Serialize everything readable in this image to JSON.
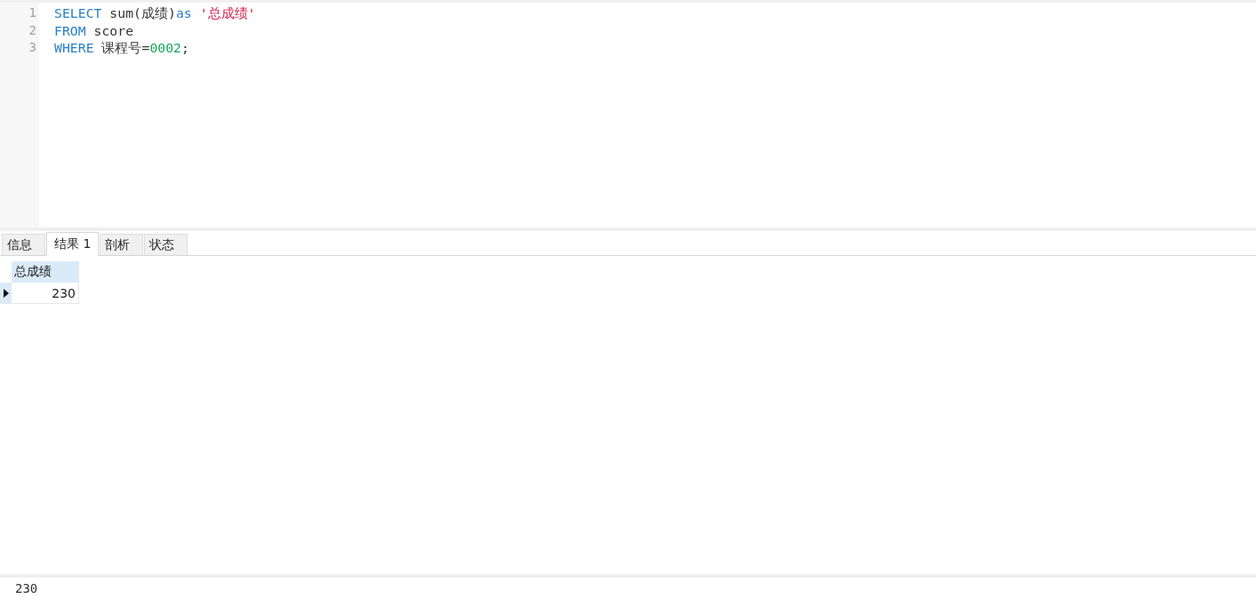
{
  "editor": {
    "lines": [
      {
        "number": "1",
        "tokens": [
          {
            "kind": "keyword",
            "text": "SELECT"
          },
          {
            "kind": "plain",
            "text": " sum(成绩)"
          },
          {
            "kind": "keyword",
            "text": "as"
          },
          {
            "kind": "string",
            "text": " '总成绩'"
          }
        ]
      },
      {
        "number": "2",
        "tokens": [
          {
            "kind": "keyword",
            "text": "FROM"
          },
          {
            "kind": "plain",
            "text": " score"
          }
        ]
      },
      {
        "number": "3",
        "tokens": [
          {
            "kind": "keyword",
            "text": "WHERE"
          },
          {
            "kind": "plain",
            "text": " 课程号="
          },
          {
            "kind": "number",
            "text": "0002"
          },
          {
            "kind": "plain",
            "text": ";"
          }
        ]
      }
    ]
  },
  "tabs": [
    {
      "label": "信息",
      "selected": false
    },
    {
      "label": "结果 1",
      "selected": true
    },
    {
      "label": "剖析",
      "selected": false
    },
    {
      "label": "状态",
      "selected": false
    }
  ],
  "result_grid": {
    "columns": [
      "总成绩"
    ],
    "rows": [
      {
        "selected": true,
        "cells": [
          "230"
        ]
      }
    ]
  },
  "status_bar": {
    "text": "230"
  }
}
